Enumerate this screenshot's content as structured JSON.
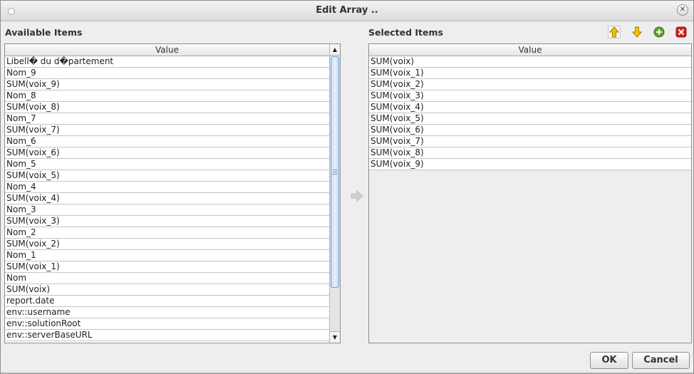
{
  "window": {
    "title": "Edit Array .."
  },
  "available": {
    "label": "Available Items",
    "column_header": "Value",
    "items": [
      "Libell� du d�partement",
      "Nom_9",
      "SUM(voix_9)",
      "Nom_8",
      "SUM(voix_8)",
      "Nom_7",
      "SUM(voix_7)",
      "Nom_6",
      "SUM(voix_6)",
      "Nom_5",
      "SUM(voix_5)",
      "Nom_4",
      "SUM(voix_4)",
      "Nom_3",
      "SUM(voix_3)",
      "Nom_2",
      "SUM(voix_2)",
      "Nom_1",
      "SUM(voix_1)",
      "Nom",
      "SUM(voix)",
      "report.date",
      "env::username",
      "env::solutionRoot",
      "env::serverBaseURL"
    ]
  },
  "selected": {
    "label": "Selected Items",
    "column_header": "Value",
    "items": [
      "SUM(voix)",
      "SUM(voix_1)",
      "SUM(voix_2)",
      "SUM(voix_3)",
      "SUM(voix_4)",
      "SUM(voix_5)",
      "SUM(voix_6)",
      "SUM(voix_7)",
      "SUM(voix_8)",
      "SUM(voix_9)"
    ]
  },
  "toolbar": {
    "icons": [
      "move-up-icon",
      "move-down-icon",
      "add-icon",
      "remove-icon"
    ]
  },
  "buttons": {
    "ok_label": "OK",
    "cancel_label": "Cancel"
  },
  "colors": {
    "arrow_yellow": "#f5c400",
    "add_green": "#5aa02c",
    "remove_red": "#d42020"
  }
}
